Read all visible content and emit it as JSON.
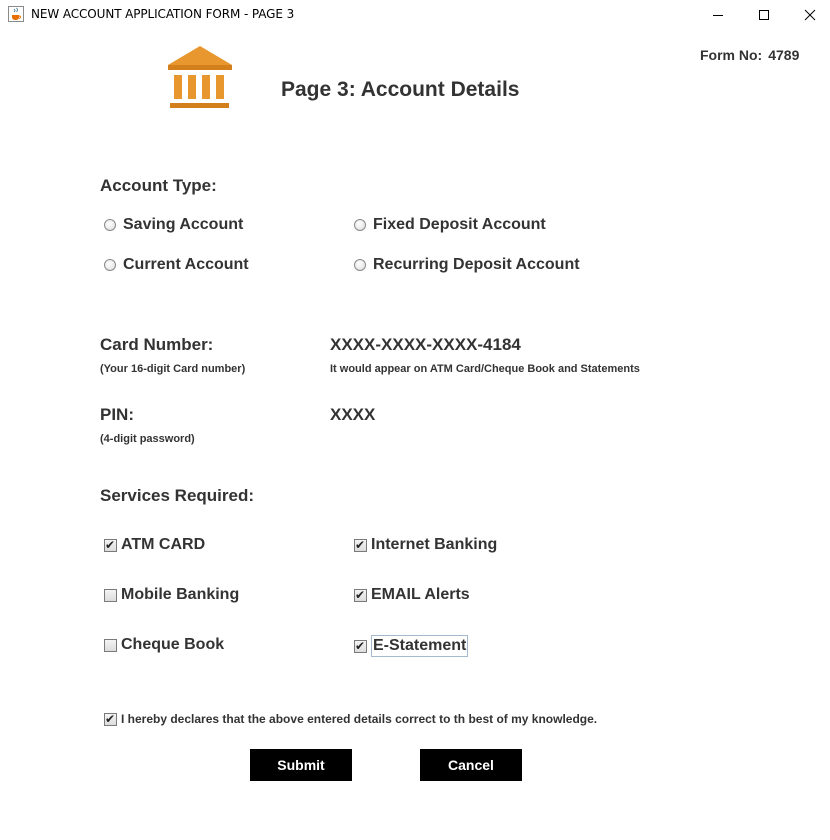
{
  "window": {
    "title": "NEW ACCOUNT APPLICATION FORM - PAGE 3",
    "controls": [
      "minimize",
      "maximize",
      "close"
    ]
  },
  "header": {
    "logo_icon": "bank-building-icon",
    "heading": "Page 3: Account Details",
    "form_no_label": "Form No:",
    "form_no_value": "4789"
  },
  "account_type": {
    "label": "Account Type:",
    "options": [
      {
        "label": "Saving Account",
        "selected": false
      },
      {
        "label": "Fixed Deposit Account",
        "selected": false
      },
      {
        "label": "Current Account",
        "selected": false
      },
      {
        "label": "Recurring Deposit Account",
        "selected": false
      }
    ]
  },
  "card": {
    "label": "Card Number:",
    "hint": "(Your 16-digit Card number)",
    "value": "XXXX-XXXX-XXXX-4184",
    "note": "It would appear on ATM Card/Cheque Book and Statements"
  },
  "pin": {
    "label": "PIN:",
    "hint": "(4-digit password)",
    "value": "XXXX"
  },
  "services": {
    "label": "Services Required:",
    "items": [
      {
        "label": "ATM CARD",
        "checked": true
      },
      {
        "label": "Internet Banking",
        "checked": true
      },
      {
        "label": "Mobile Banking",
        "checked": false
      },
      {
        "label": "EMAIL Alerts",
        "checked": true
      },
      {
        "label": "Cheque Book",
        "checked": false
      },
      {
        "label": "E-Statement",
        "checked": true
      }
    ]
  },
  "declaration": {
    "text": "I hereby declares that the above entered details correct to th best of my knowledge.",
    "checked": true
  },
  "buttons": {
    "submit": "Submit",
    "cancel": "Cancel"
  },
  "colors": {
    "logo_orange": "#e8962e",
    "button_bg": "#000000",
    "button_text": "#ffffff",
    "text": "#333333"
  }
}
